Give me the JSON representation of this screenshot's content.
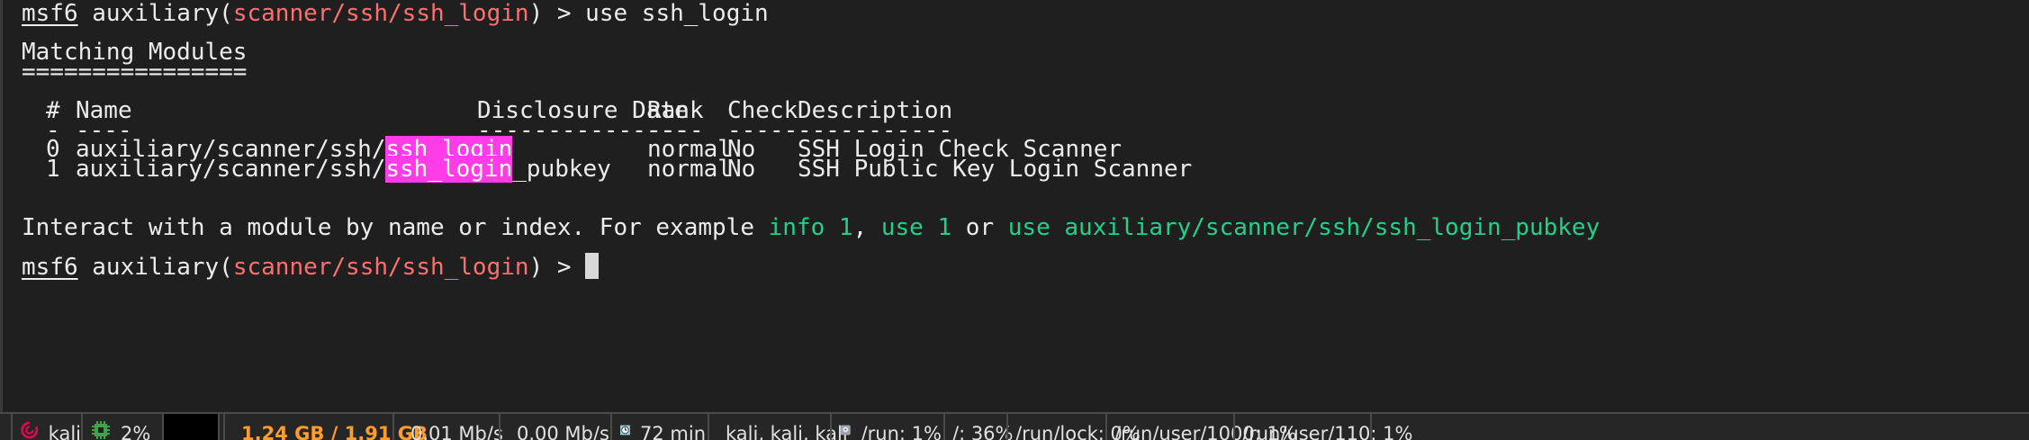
{
  "terminal": {
    "line1": {
      "prompt": "msf6",
      "mod_prefix": "auxiliary(",
      "mod_path": "scanner/ssh/ssh_login",
      "mod_suffix": ")",
      "command": " > use ssh_login"
    },
    "heading": "Matching Modules",
    "heading_rule": "================",
    "table": {
      "headers": [
        "#",
        "Name",
        "Disclosure Date",
        "Rank",
        "Check",
        "Description"
      ],
      "rules": [
        "-",
        "----",
        "---------------",
        "----",
        "-----",
        "-----------"
      ],
      "rows": [
        {
          "num": "0",
          "name_prefix": "auxiliary/scanner/ssh/",
          "name_match": "ssh_login",
          "name_suffix": "",
          "date": "",
          "rank": "normal",
          "check": "No",
          "description": "SSH Login Check Scanner"
        },
        {
          "num": "1",
          "name_prefix": "auxiliary/scanner/ssh/",
          "name_match": "ssh_login",
          "name_suffix": "_pubkey",
          "date": "",
          "rank": "normal",
          "check": "No",
          "description": "SSH Public Key Login Scanner"
        }
      ]
    },
    "hint": {
      "text1": "Interact with a module by name or index. For example ",
      "cmd1": "info 1",
      "sep1": ", ",
      "cmd2": "use 1",
      "sep2": " or ",
      "cmd3": "use auxiliary/scanner/ssh/ssh_login_pubkey"
    },
    "line_last": {
      "prompt": "msf6",
      "mod_prefix": "auxiliary(",
      "mod_path": "scanner/ssh/ssh_login",
      "mod_suffix": ")",
      "command": " > "
    }
  },
  "statusbar": {
    "host": "kali",
    "cpu": "2%",
    "memory": "1.24 GB / 1.91 GB",
    "upload": "0.01 Mb/s",
    "download": "0.00 Mb/s",
    "uptime": "72 min",
    "users": "kali, kali, kali",
    "disk_run": "/run: 1%",
    "disk_root": "/: 36%",
    "disk_run_lock": "/run/lock: 0%",
    "disk_user1000": "/run/user/1000: 1%",
    "disk_user110": "/run/user/110: 1%"
  },
  "colors": {
    "prompt_path": "#ff6f6f",
    "hint_cmd": "#23d18b",
    "match_highlight": "#ff3ce5",
    "memory": "#ff9d2c"
  }
}
